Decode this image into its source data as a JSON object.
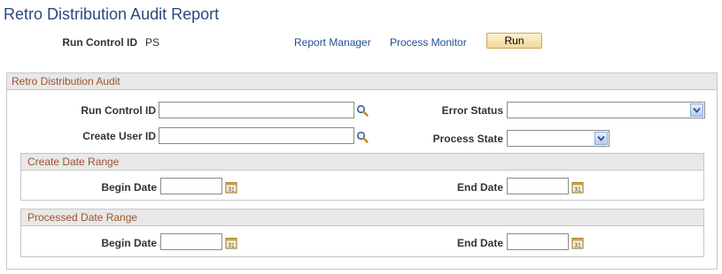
{
  "page_title": "Retro Distribution Audit Report",
  "run_control": {
    "label": "Run Control ID",
    "value": "PS"
  },
  "links": {
    "report_manager": "Report Manager",
    "process_monitor": "Process Monitor"
  },
  "run_button": "Run",
  "audit_section": {
    "header": "Retro Distribution Audit",
    "run_control_id_label": "Run Control ID",
    "run_control_id_value": "",
    "create_user_id_label": "Create User ID",
    "create_user_id_value": "",
    "error_status_label": "Error Status",
    "error_status_value": "",
    "process_state_label": "Process State",
    "process_state_value": ""
  },
  "create_date_range": {
    "header": "Create Date Range",
    "begin_label": "Begin Date",
    "begin_value": "",
    "end_label": "End Date",
    "end_value": ""
  },
  "processed_date_range": {
    "header": "Processed Date Range",
    "begin_label": "Begin Date",
    "begin_value": "",
    "end_label": "End Date",
    "end_value": ""
  },
  "colors": {
    "title": "#2c4a7c",
    "section_header_text": "#a0522d",
    "link": "#1f4f8f",
    "button": "#f3d796"
  },
  "icons": {
    "lookup": "magnifier-icon",
    "calendar": "calendar-icon",
    "dropdown": "chevron-down-icon"
  }
}
